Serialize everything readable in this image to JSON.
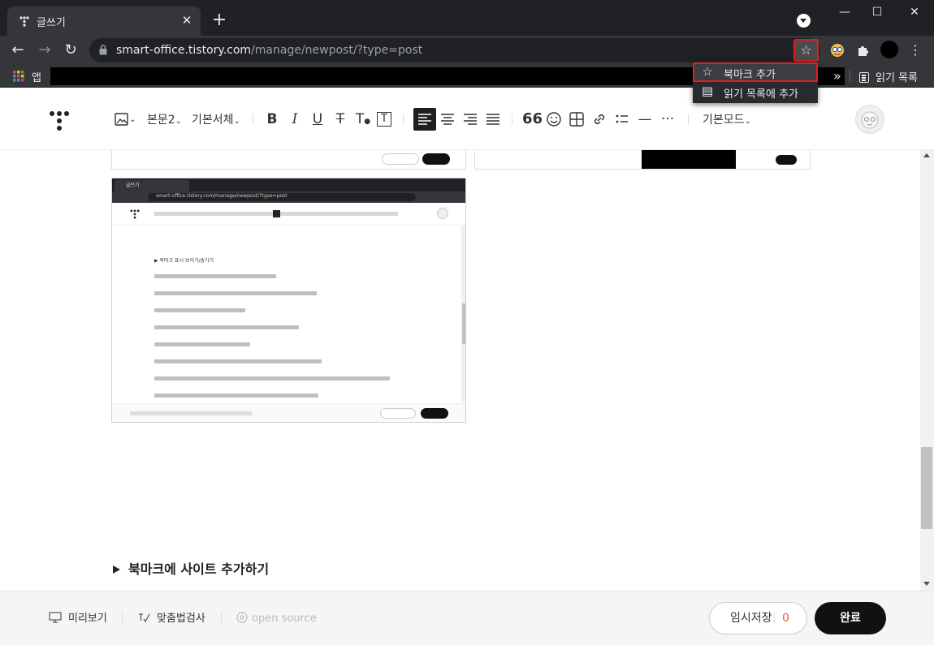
{
  "browser": {
    "tab_title": "글쓰기",
    "tab_close": "✕",
    "new_tab": "+",
    "window_controls": {
      "minimize": "—",
      "maximize": "☐",
      "close": "✕"
    },
    "url_host": "smart-office.tistory.com",
    "url_path": "/manage/newpost/?type=post",
    "bookmarks_bar": {
      "apps_label": "앱",
      "overflow": "»",
      "reading_list_label": "읽기 목록"
    },
    "bookmark_menu": {
      "items": [
        {
          "label": "북마크 추가",
          "icon": "star-icon"
        },
        {
          "label": "읽기 목록에 추가",
          "icon": "reading-list-add-icon"
        }
      ]
    },
    "highlight_color": "#e01e1e"
  },
  "editor": {
    "toolbar": {
      "paragraph_style": "본문2",
      "font_family": "기본서체",
      "mode": "기본모드",
      "icons": [
        "image-icon",
        "bold-icon",
        "italic-icon",
        "underline-icon",
        "strikethrough-icon",
        "text-color-icon",
        "text-background-icon",
        "align-left-icon",
        "align-center-icon",
        "align-right-icon",
        "align-justify-icon",
        "quote-icon",
        "emoji-icon",
        "table-icon",
        "link-icon",
        "list-icon",
        "divider-icon",
        "more-icon"
      ]
    },
    "content": {
      "section_heading": "북마크에 사이트 추가하기",
      "embedded_screenshot": {
        "tab_title": "글쓰기",
        "url": "smart-office.tistory.com/manage/newpost/?type=post",
        "heading": "▶ 북마크 표시 보이기/숨기기"
      }
    }
  },
  "bottombar": {
    "preview": "미리보기",
    "spellcheck": "맞춤법검사",
    "open_source": "open source",
    "temp_save": "임시저장",
    "temp_save_count": "0",
    "publish": "완료",
    "accent": "#ee5c2c"
  }
}
